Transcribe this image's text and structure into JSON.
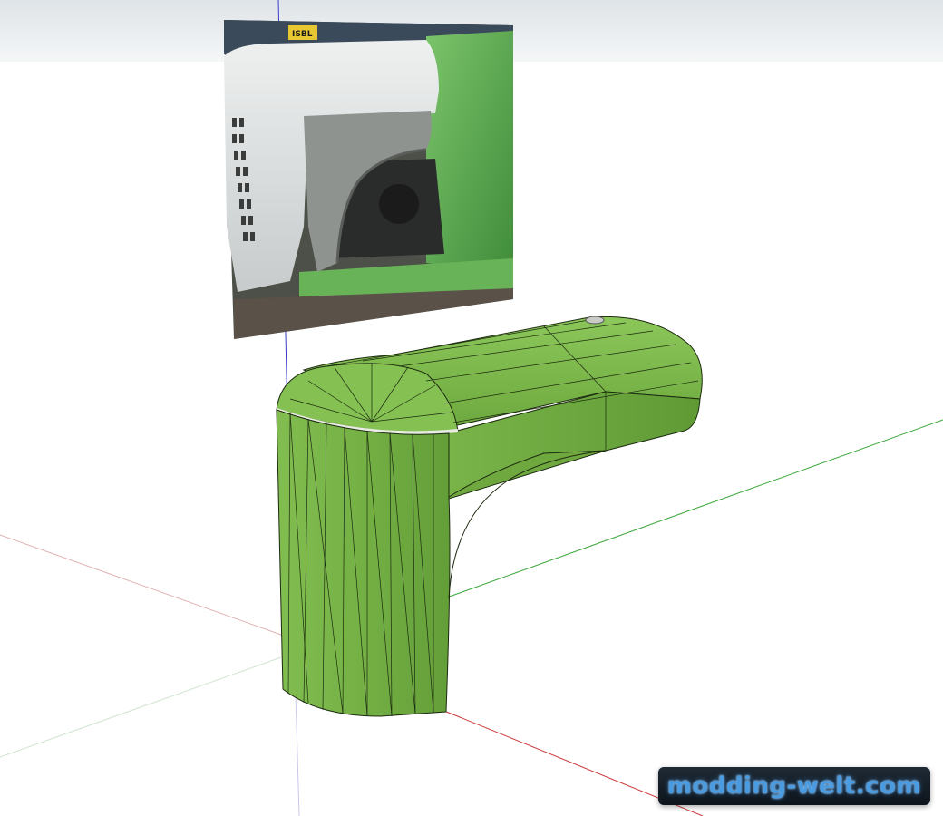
{
  "app": {
    "scene": "3d-modeling-viewport"
  },
  "reference_photo": {
    "sign_text": "ISBL",
    "colors": {
      "hood_white": "#d9dcdc",
      "tractor_green": "#5fae52",
      "engine_dark": "#2a2c2b"
    }
  },
  "model": {
    "shape": "fender",
    "color": "#7bb84a",
    "edge_color": "#1c2a10"
  },
  "axes": {
    "blue": "#3a3ad0",
    "green": "#3aa83a",
    "red": "#cc3a3a"
  },
  "watermark": {
    "text": "modding-welt.com"
  }
}
